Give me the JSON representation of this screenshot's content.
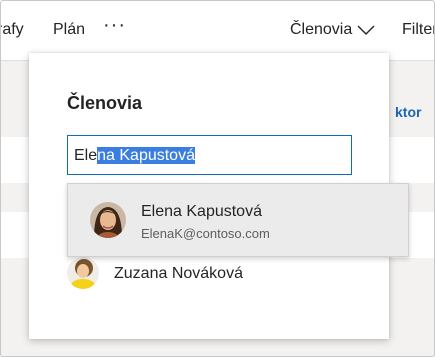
{
  "toolbar": {
    "grafy_label": "rafy",
    "plan_label": "Plán",
    "more_label": "···",
    "members_label": "Členovia",
    "filter_label": "Filter"
  },
  "background": {
    "link_label": "ktor"
  },
  "members_panel": {
    "title": "Členovia",
    "search": {
      "typed": "Ele",
      "autocomplete": "na Kapustová"
    },
    "members": [
      {
        "name": "Zuzana Nováková",
        "avatar": "avatar-photo"
      }
    ]
  },
  "suggestion": {
    "name": "Elena Kapustová",
    "email": "ElenaK@contoso.com",
    "avatar": "avatar-photo"
  },
  "colors": {
    "accent": "#0f6cbd",
    "selection": "#3a7ee0",
    "link": "#1b64b5",
    "dropdown_bg": "#ebebeb"
  }
}
